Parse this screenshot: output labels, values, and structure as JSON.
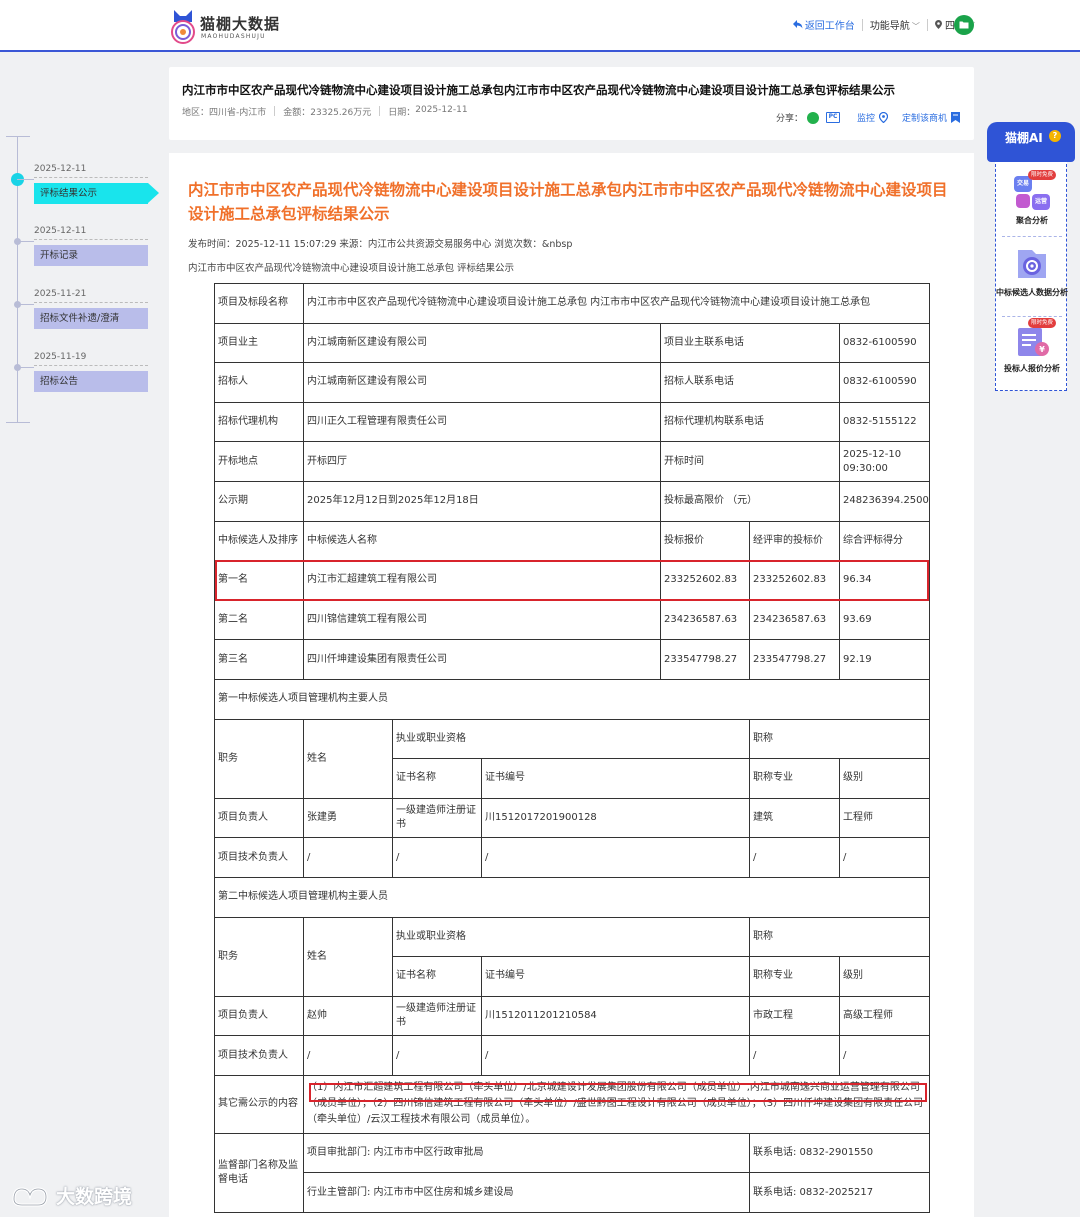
{
  "brand": {
    "name": "猫棚大数据",
    "sub": "MAOHUDASHUJU"
  },
  "topnav": {
    "back": "返回工作台",
    "nav": "功能导航",
    "region": "四川"
  },
  "header": {
    "title": "内江市市中区农产品现代冷链物流中心建设项目设计施工总承包内江市市中区农产品现代冷链物流中心建设项目设计施工总承包评标结果公示",
    "area_label": "地区：",
    "area": "四川省-内江市",
    "amount_label": "金额：",
    "amount": "23325.26万元",
    "date_label": "日期：",
    "date": "2025-12-11",
    "share": "分享：",
    "monitor": "监控",
    "custom": "定制该商机"
  },
  "timeline": [
    {
      "date": "2025-12-11",
      "label": "评标结果公示"
    },
    {
      "date": "2025-12-11",
      "label": "开标记录"
    },
    {
      "date": "2025-11-21",
      "label": "招标文件补遗/澄清"
    },
    {
      "date": "2025-11-19",
      "label": "招标公告"
    }
  ],
  "main": {
    "title": "内江市市中区农产品现代冷链物流中心建设项目设计施工总承包内江市市中区农产品现代冷链物流中心建设项目设计施工总承包评标结果公示",
    "info": "发布时间：2025-12-11 15:07:29   来源：内江市公共资源交易服务中心   浏览次数：&nbsp",
    "subtitle": "内江市市中区农产品现代冷链物流中心建设项目设计施工总承包 评标结果公示"
  },
  "table": {
    "r_project_label": "项目及标段名称",
    "r_project_value": "内江市市中区农产品现代冷链物流中心建设项目设计施工总承包 内江市市中区农产品现代冷链物流中心建设项目设计施工总承包",
    "owner_label": "项目业主",
    "owner": "内江城南新区建设有限公司",
    "owner_tel_label": "项目业主联系电话",
    "owner_tel": "0832-6100590",
    "tenderer_label": "招标人",
    "tenderer": "内江城南新区建设有限公司",
    "tenderer_tel_label": "招标人联系电话",
    "tenderer_tel": "0832-6100590",
    "agent_label": "招标代理机构",
    "agent": "四川正久工程管理有限责任公司",
    "agent_tel_label": "招标代理机构联系电话",
    "agent_tel": "0832-5155122",
    "place_label": "开标地点",
    "place": "开标四厅",
    "time_label": "开标时间",
    "time": "2025-12-10 09:30:00",
    "period_label": "公示期",
    "period": "2025年12月12日到2025年12月18日",
    "max_label": "投标最高限价 （元）",
    "max": "248236394.2500",
    "cand_h1": "中标候选人及排序",
    "cand_h2": "中标候选人名称",
    "cand_h3": "投标报价",
    "cand_h4": "经评审的投标价",
    "cand_h5": "综合评标得分",
    "candidates": [
      {
        "rank": "第一名",
        "name": "内江市汇超建筑工程有限公司",
        "bid": "233252602.83",
        "eval": "233252602.83",
        "score": "96.34"
      },
      {
        "rank": "第二名",
        "name": "四川锦信建筑工程有限公司",
        "bid": "234236587.63",
        "eval": "234236587.63",
        "score": "93.69"
      },
      {
        "rank": "第三名",
        "name": "四川仟坤建设集团有限责任公司",
        "bid": "233547798.27",
        "eval": "233547798.27",
        "score": "92.19"
      }
    ],
    "staff1_title": "第一中标候选人项目管理机构主要人员",
    "staff2_title": "第二中标候选人项目管理机构主要人员",
    "h_duty": "职务",
    "h_name": "姓名",
    "h_qual": "执业或职业资格",
    "h_title": "职称",
    "h_cert": "证书名称",
    "h_certno": "证书编号",
    "h_major": "职称专业",
    "h_level": "级别",
    "s1": {
      "duty": "项目负责人",
      "name": "张建勇",
      "cert": "一级建造师注册证书",
      "certno": "川1512017201900128",
      "major": "建筑",
      "level": "工程师"
    },
    "s1b": {
      "duty": "项目技术负责人",
      "name": "/",
      "cert": "/",
      "certno": "/",
      "major": "/",
      "level": "/"
    },
    "s2": {
      "duty": "项目负责人",
      "name": "赵帅",
      "cert": "一级建造师注册证书",
      "certno": "川1512011201210584",
      "major": "市政工程",
      "level": "高级工程师"
    },
    "s2b": {
      "duty": "项目技术负责人",
      "name": "/",
      "cert": "/",
      "certno": "/",
      "major": "/",
      "level": "/"
    },
    "other_label": "其它需公示的内容",
    "other": "（1）内江市汇超建筑工程有限公司（牵头单位）/北京城建设计发展集团股份有限公司（成员单位）,内江市城南逸兴商业运营管理有限公司（成员单位）；（2）四川锦信建筑工程有限公司（牵头单位）/盛世黔图工程设计有限公司（成员单位）；（3）四川仟坤建设集团有限责任公司（牵头单位）/云汉工程技术有限公司（成员单位）。",
    "sup_label": "监督部门名称及监督电话",
    "sup1": "项目审批部门: 内江市市中区行政审批局",
    "sup1_tel": "联系电话: 0832-2901550",
    "sup2": "行业主管部门: 内江市市中区住房和城乡建设局",
    "sup2_tel": "联系电话: 0832-2025217"
  },
  "ai": {
    "title": "猫棚AI",
    "q": "?",
    "free": "限时免费",
    "items": [
      {
        "label": "聚合分析",
        "a": "交易",
        "b": "运营"
      },
      {
        "label": "中标候选人数据分析"
      },
      {
        "label": "投标人报价分析"
      }
    ]
  },
  "watermark": "大数跨境",
  "colors": {
    "accent": "#3b57d6",
    "title_orange": "#f0702a",
    "timeline_active": "#19e4ec",
    "highlight_red": "#d8242c"
  }
}
